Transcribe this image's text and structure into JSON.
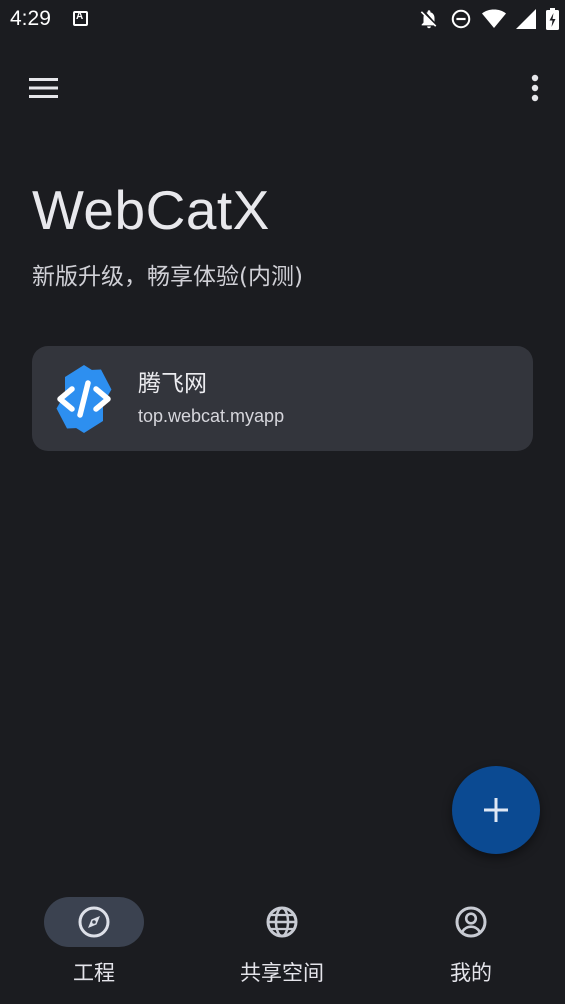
{
  "status_bar": {
    "time": "4:29",
    "notification_icon": "a-icon",
    "icons": [
      "bell-off-icon",
      "do-not-disturb-icon",
      "wifi-icon",
      "signal-icon",
      "battery-charging-icon"
    ]
  },
  "app_bar": {
    "menu_icon": "menu-icon",
    "more_icon": "more-vert-icon"
  },
  "header": {
    "title": "WebCatX",
    "subtitle": "新版升级，畅享体验(内测)"
  },
  "projects": [
    {
      "name": "腾飞网",
      "package": "top.webcat.myapp",
      "icon": "code-hexagon-icon"
    }
  ],
  "fab": {
    "icon": "plus-icon"
  },
  "bottom_nav": {
    "items": [
      {
        "label": "工程",
        "icon": "compass-icon",
        "active": true
      },
      {
        "label": "共享空间",
        "icon": "globe-icon",
        "active": false
      },
      {
        "label": "我的",
        "icon": "account-circle-icon",
        "active": false
      }
    ]
  },
  "colors": {
    "background": "#1b1c20",
    "card": "#33353c",
    "fab": "#0b4a92",
    "nav_active_pill": "#3b4250",
    "icon_blue": "#2d8ff0"
  }
}
